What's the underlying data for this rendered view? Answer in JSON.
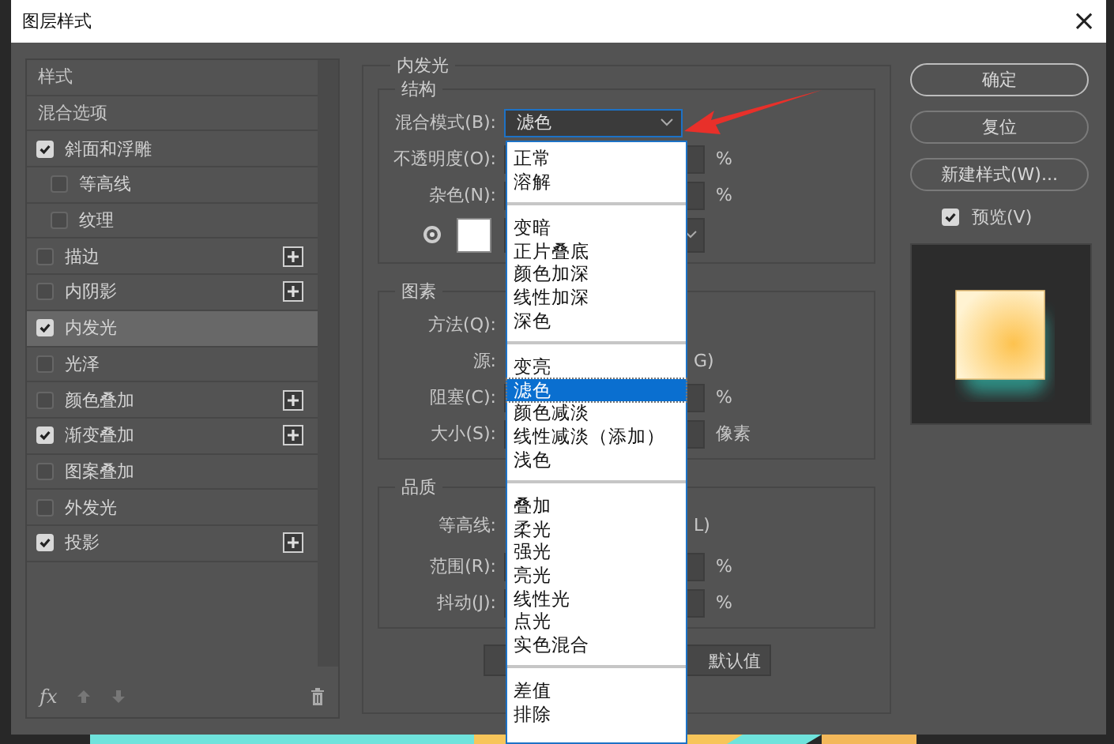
{
  "window": {
    "title": "图层样式",
    "close": "×"
  },
  "styles": [
    {
      "kind": "header",
      "label": "样式",
      "selected": false
    },
    {
      "kind": "header",
      "label": "混合选项",
      "selected": false
    },
    {
      "kind": "effect",
      "label": "斜面和浮雕",
      "checked": true,
      "selected": false,
      "addable": false,
      "children": [
        {
          "kind": "effect",
          "label": "等高线",
          "checked": false,
          "selected": false,
          "addable": false
        },
        {
          "kind": "effect",
          "label": "纹理",
          "checked": false,
          "selected": false,
          "addable": false
        }
      ]
    },
    {
      "kind": "effect",
      "label": "描边",
      "checked": false,
      "selected": false,
      "addable": true
    },
    {
      "kind": "effect",
      "label": "内阴影",
      "checked": false,
      "selected": false,
      "addable": true
    },
    {
      "kind": "effect",
      "label": "内发光",
      "checked": true,
      "selected": true,
      "addable": false
    },
    {
      "kind": "effect",
      "label": "光泽",
      "checked": false,
      "selected": false,
      "addable": false
    },
    {
      "kind": "effect",
      "label": "颜色叠加",
      "checked": false,
      "selected": false,
      "addable": true
    },
    {
      "kind": "effect",
      "label": "渐变叠加",
      "checked": true,
      "selected": false,
      "addable": true
    },
    {
      "kind": "effect",
      "label": "图案叠加",
      "checked": false,
      "selected": false,
      "addable": false
    },
    {
      "kind": "effect",
      "label": "外发光",
      "checked": false,
      "selected": false,
      "addable": false
    },
    {
      "kind": "effect",
      "label": "投影",
      "checked": true,
      "selected": false,
      "addable": true
    }
  ],
  "footer": {
    "fx": "fx"
  },
  "panel": {
    "title": "内发光",
    "groups": [
      {
        "title": "结构",
        "rows": [
          {
            "kind": "select",
            "label": "混合模式(B):",
            "value": "滤色"
          },
          {
            "kind": "number",
            "label": "不透明度(O):",
            "unit": "%"
          },
          {
            "kind": "number",
            "label": "杂色(N):",
            "unit": "%"
          },
          {
            "kind": "color",
            "selected": true
          }
        ]
      },
      {
        "title": "图素",
        "rows": [
          {
            "kind": "plain",
            "label": "方法(Q):"
          },
          {
            "kind": "plain",
            "label": "源:",
            "tail": "G)"
          },
          {
            "kind": "number",
            "label": "阻塞(C):",
            "unit": "%"
          },
          {
            "kind": "number",
            "label": "大小(S):",
            "unit": "像素"
          }
        ]
      },
      {
        "title": "品质",
        "rows": [
          {
            "kind": "contour",
            "label": "等高线:",
            "tail": "L)"
          },
          {
            "kind": "number",
            "label": "范围(R):",
            "unit": "%"
          },
          {
            "kind": "number",
            "label": "抖动(J):",
            "unit": "%"
          }
        ]
      }
    ],
    "buttons": [
      {
        "kind": "covered"
      },
      {
        "kind": "text",
        "label": "默认值"
      }
    ]
  },
  "dropdown": {
    "groups": [
      [
        {
          "label": "正常",
          "selected": false
        },
        {
          "label": "溶解",
          "selected": false
        }
      ],
      [
        {
          "label": "变暗",
          "selected": false
        },
        {
          "label": "正片叠底",
          "selected": false
        },
        {
          "label": "颜色加深",
          "selected": false
        },
        {
          "label": "线性加深",
          "selected": false
        },
        {
          "label": "深色",
          "selected": false
        }
      ],
      [
        {
          "label": "变亮",
          "selected": false
        },
        {
          "label": "滤色",
          "selected": true
        },
        {
          "label": "颜色减淡",
          "selected": false
        },
        {
          "label": "线性减淡（添加）",
          "selected": false
        },
        {
          "label": "浅色",
          "selected": false
        }
      ],
      [
        {
          "label": "叠加",
          "selected": false
        },
        {
          "label": "柔光",
          "selected": false
        },
        {
          "label": "强光",
          "selected": false
        },
        {
          "label": "亮光",
          "selected": false
        },
        {
          "label": "线性光",
          "selected": false
        },
        {
          "label": "点光",
          "selected": false
        },
        {
          "label": "实色混合",
          "selected": false
        }
      ],
      [
        {
          "label": "差值",
          "selected": false
        },
        {
          "label": "排除",
          "selected": false
        }
      ]
    ]
  },
  "actions": [
    {
      "label": "确定",
      "default": true
    },
    {
      "label": "复位",
      "default": false
    },
    {
      "label": "新建样式(W)...",
      "default": false
    }
  ],
  "preview": {
    "label": "预览(V)",
    "checked": true
  }
}
